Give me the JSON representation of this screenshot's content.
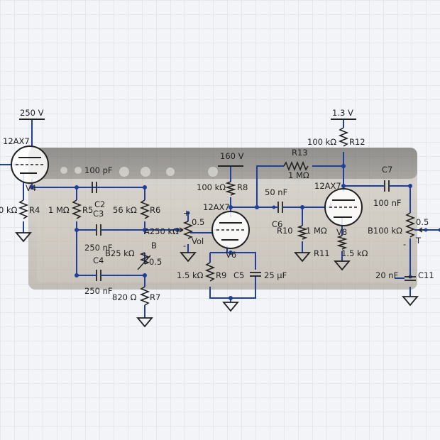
{
  "colors": {
    "wire": "#1f3f9a",
    "node": "#1f3f9a",
    "component": "#222222",
    "grid": "#d7dbe8",
    "amp_body": "#8f8a82",
    "background": "#f3f4f8"
  },
  "supplies": {
    "left": "250 V",
    "middle": "160 V",
    "right": "1.3 V"
  },
  "tubes": {
    "v4_type": "12AX7",
    "v4_ref": "V4",
    "v6_type": "12AX7",
    "v6_ref": "V6",
    "v8_type": "12AX7",
    "v8_ref": "V8"
  },
  "components": {
    "r4_value": "0 kΩ",
    "r4_ref": "R4",
    "r5_value": "1 MΩ",
    "r5_ref": "R5",
    "c2_value": "100 pF",
    "c2_ref": "C2",
    "c3_value": "250 nF",
    "c3_ref": "C3",
    "c4_value": "250 nF",
    "c4_ref": "C4",
    "r6_value": "56 kΩ",
    "r6_ref": "R6",
    "treble_value": "A250 kΩ",
    "treble_tag": "A",
    "bass_value": "B25 kΩ",
    "bass_tag": "B",
    "bass_wiper": "0.5",
    "r7_value": "820 Ω",
    "r7_ref": "R7",
    "vol_wiper": "0.5",
    "vol_label": "Vol",
    "r8_value": "100 kΩ",
    "r8_ref": "R8",
    "r9_value": "1.5 kΩ",
    "r9_ref": "R9",
    "c5_value": "25 µF",
    "c5_ref": "C5",
    "c6_value": "50 nF",
    "c6_ref": "C6",
    "r13_value": "1 MΩ",
    "r13_ref": "R13",
    "r10_value": "1 MΩ",
    "r10_ref": "R10",
    "r12_value": "100 kΩ",
    "r12_ref": "R12",
    "r11_value": "1.5 kΩ",
    "r11_ref": "R11",
    "c7_value": "100 nF",
    "c7_ref": "C7",
    "pot_out_value": "B100 kΩ",
    "pot_out_wiper": "0.5",
    "pot_out_tag": "T",
    "c11_value": "20 nF",
    "c11_ref": "C11"
  }
}
